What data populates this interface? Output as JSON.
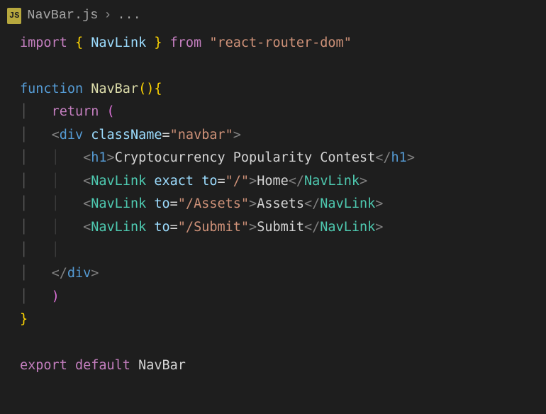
{
  "breadcrumb": {
    "icon": "JS",
    "file": "NavBar.js",
    "sep": "›",
    "rest": "..."
  },
  "code": {
    "import": {
      "kw": "import",
      "from": "from",
      "ident": "NavLink",
      "module": "\"react-router-dom\""
    },
    "fn": {
      "kw": "function",
      "name": "NavBar",
      "ret": "return"
    },
    "jsx": {
      "rootTag": "div",
      "rootAttr": "className",
      "rootAttrVal": "\"navbar\"",
      "h1": {
        "tag": "h1",
        "text": "Cryptocurrency Popularity Contest"
      },
      "link1": {
        "tag": "NavLink",
        "attr1": "exact",
        "attr2": "to",
        "val": "\"/\"",
        "text": "Home"
      },
      "link2": {
        "tag": "NavLink",
        "attr": "to",
        "val": "\"/Assets\"",
        "text": "Assets"
      },
      "link3": {
        "tag": "NavLink",
        "attr": "to",
        "val": "\"/Submit\"",
        "text": "Submit"
      }
    },
    "export": {
      "export": "export",
      "default": "default",
      "name": "NavBar"
    }
  }
}
